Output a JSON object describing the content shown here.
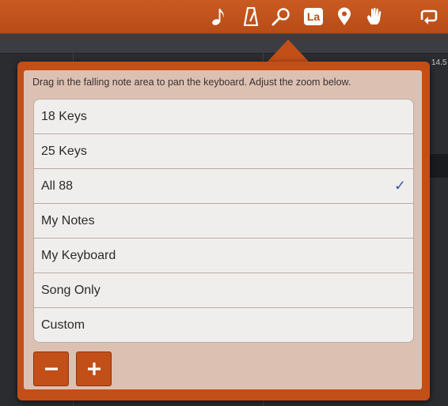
{
  "toolbar": {
    "icons": [
      "note-icon",
      "metronome-icon",
      "zoom-icon",
      "la-icon",
      "location-pin-icon",
      "hand-icon",
      "loop-icon"
    ],
    "la_label": "La",
    "accent": "#c24f18"
  },
  "background": {
    "tick_label": "14.5"
  },
  "zoom_popover": {
    "hint": "Drag in the falling note area to pan the keyboard.  Adjust the zoom below.",
    "options": [
      {
        "label": "18 Keys",
        "selected": false
      },
      {
        "label": "25 Keys",
        "selected": false
      },
      {
        "label": "All 88",
        "selected": true
      },
      {
        "label": "My Notes",
        "selected": false
      },
      {
        "label": "My Keyboard",
        "selected": false
      },
      {
        "label": "Song Only",
        "selected": false
      },
      {
        "label": "Custom",
        "selected": false
      }
    ],
    "check_glyph": "✓",
    "minus_label": "−",
    "plus_label": "+"
  }
}
